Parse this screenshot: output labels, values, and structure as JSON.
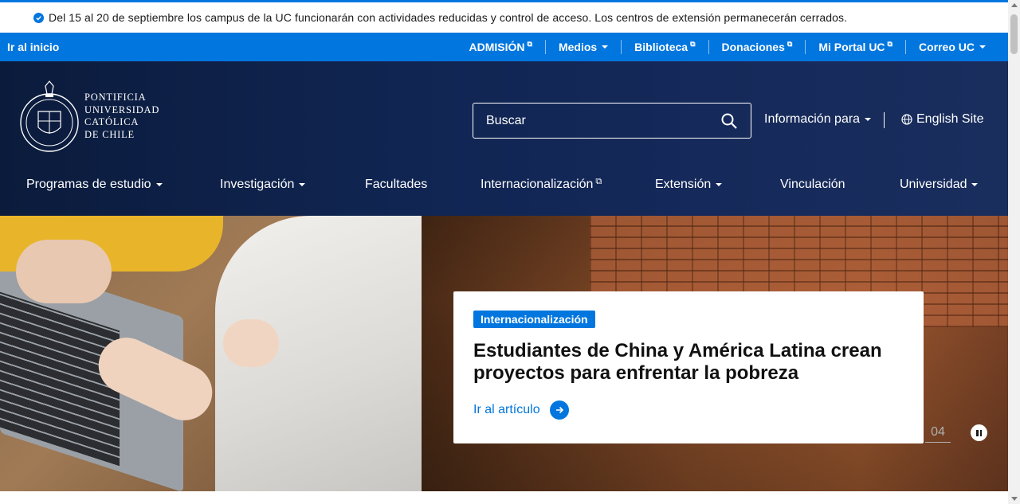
{
  "alert": {
    "message": "Del 15 al 20 de septiembre los campus de la UC funcionarán con actividades reducidas y control de acceso. Los centros de extensión permanecerán cerrados.",
    "icon": "check-circle-icon"
  },
  "topbar": {
    "home_label": "Ir al inicio",
    "links": [
      {
        "label": "ADMISIÓN",
        "external": true
      },
      {
        "label": "Medios",
        "dropdown": true
      },
      {
        "label": "Biblioteca",
        "external": true
      },
      {
        "label": "Donaciones",
        "external": true
      },
      {
        "label": "Mi Portal UC",
        "external": true
      },
      {
        "label": "Correo UC",
        "dropdown": true
      }
    ]
  },
  "header": {
    "logo_lines": [
      "PONTIFICIA",
      "UNIVERSIDAD",
      "CATÓLICA",
      "DE CHILE"
    ],
    "search_placeholder": "Buscar",
    "info_label": "Información para",
    "english_label": "English Site"
  },
  "nav": {
    "items": [
      {
        "label": "Programas de estudio",
        "dropdown": true
      },
      {
        "label": "Investigación",
        "dropdown": true
      },
      {
        "label": "Facultades"
      },
      {
        "label": "Internacionalización",
        "external": true
      },
      {
        "label": "Extensión",
        "dropdown": true
      },
      {
        "label": "Vinculación"
      },
      {
        "label": "Universidad",
        "dropdown": true
      }
    ]
  },
  "hero": {
    "tag": "Internacionalización",
    "title": "Estudiantes de China y América Latina crean proyectos para enfrentar la pobreza",
    "cta": "Ir al artículo",
    "counter": "04"
  },
  "colors": {
    "brand_blue": "#0176de",
    "header_navy": "#102552"
  }
}
